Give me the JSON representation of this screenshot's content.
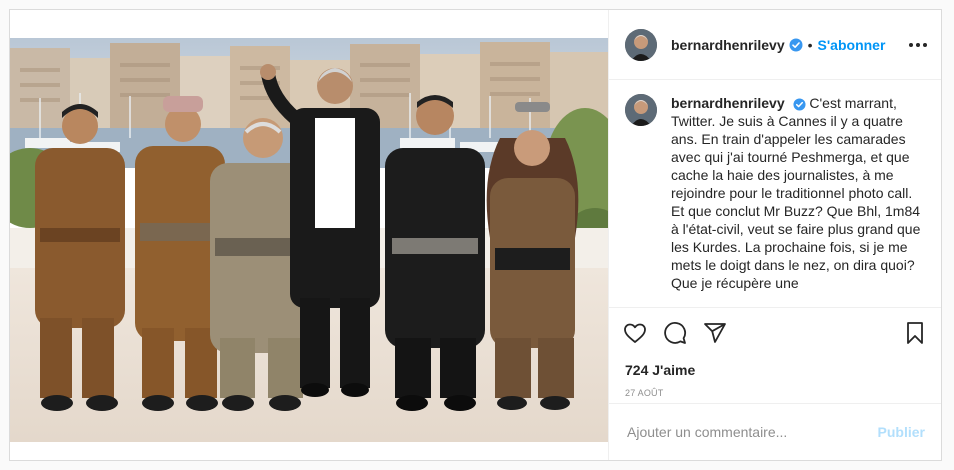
{
  "post": {
    "username": "bernardhenrilevy",
    "follow_label": "S'abonner",
    "separator": "•",
    "caption_text": "C'est marrant, Twitter. Je suis à Cannes il y a quatre ans. En train d'appeler les camarades avec qui j'ai tourné Peshmerga, et que cache la haie des journalistes, à me rejoindre pour le traditionnel photo call. Et que conclut Mr Buzz? Que Bhl, 1m84 à l'état-civil, veut se faire plus grand que les Kurdes. La prochaine fois, si je me mets le doigt dans le nez, on dira quoi? Que je récupère une",
    "likes": "724 J'aime",
    "date": "27 AOÛT",
    "comment_placeholder": "Ajouter un commentaire...",
    "publish_label": "Publier"
  },
  "icons": {
    "verified": "verified-badge-icon",
    "more": "more-options-icon",
    "like": "heart-icon",
    "comment": "comment-bubble-icon",
    "share": "paper-plane-icon",
    "save": "bookmark-icon"
  },
  "colors": {
    "accent": "#0095f6",
    "publish_disabled": "#b2dffc",
    "text": "#262626",
    "muted": "#8e8e8e"
  }
}
